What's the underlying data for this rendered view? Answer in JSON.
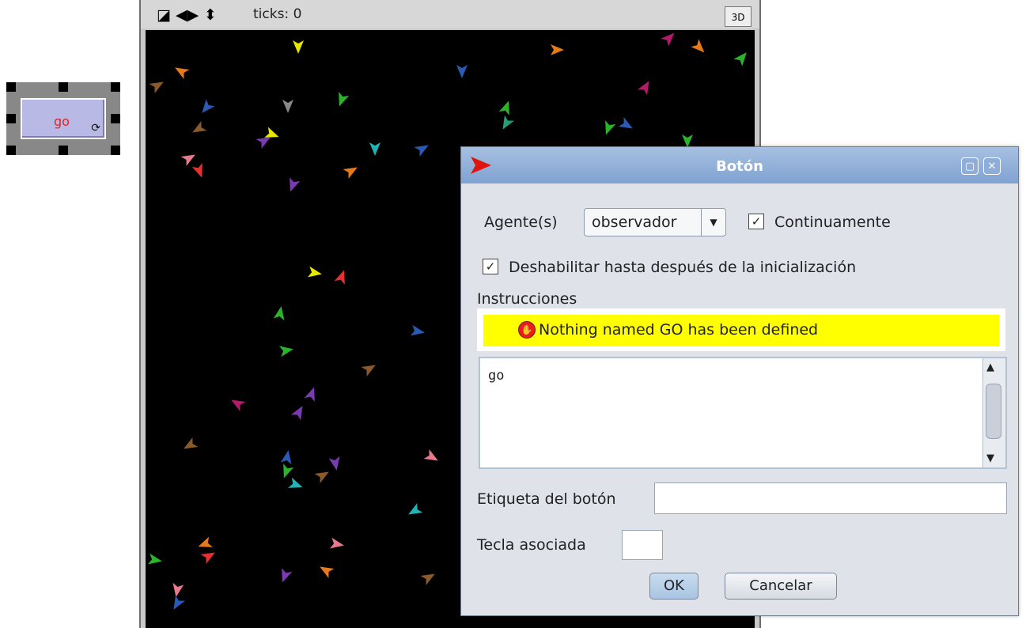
{
  "go_button": {
    "label": "go",
    "forever_icon": "forever-arrows-icon"
  },
  "view": {
    "toolbar_icons": [
      "resize-diagonal-icon",
      "resize-horizontal-icon",
      "resize-vertical-icon"
    ],
    "ticks_label": "ticks: 0",
    "btn_3d": "3D",
    "background_color": "#000000"
  },
  "dialog": {
    "title": "Botón",
    "title_icon": "red-arrow-icon",
    "agents_label": "Agente(s)",
    "agents_selected": "observador",
    "forever_label": "Continuamente",
    "forever_checked": true,
    "disable_label": "Deshabilitar hasta después de la inicialización",
    "disable_checked": true,
    "instructions_label": "Instrucciones",
    "error_message": "Nothing named GO has been defined",
    "code": "go",
    "button_label_label": "Etiqueta del botón",
    "button_label_value": "",
    "key_label": "Tecla asociada",
    "key_value": "",
    "ok_label": "OK",
    "cancel_label": "Cancelar",
    "checkmark": "✓",
    "restore_glyph": "▢",
    "close_glyph": "✕",
    "dropdown_glyph": "▼",
    "scroll_up_glyph": "▲",
    "scroll_down_glyph": "▼",
    "stop_glyph": "✋"
  }
}
